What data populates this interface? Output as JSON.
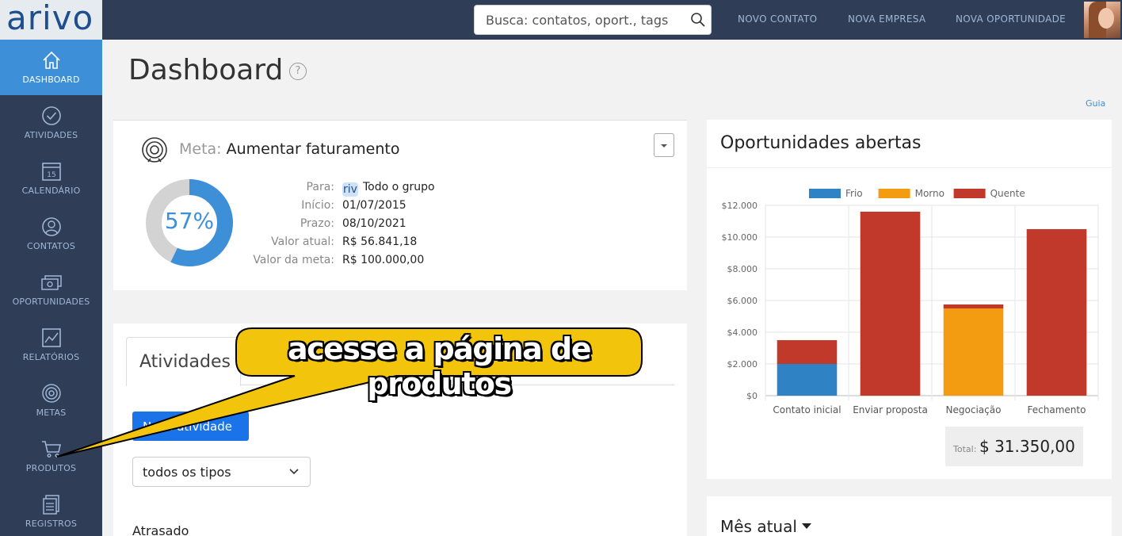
{
  "app": {
    "logo": "arivo"
  },
  "header": {
    "search_placeholder": "Busca: contatos, oport., tags",
    "links": [
      "NOVO CONTATO",
      "NOVA EMPRESA",
      "NOVA OPORTUNIDADE"
    ]
  },
  "sidebar": {
    "items": [
      {
        "label": "DASHBOARD",
        "icon": "home-icon",
        "active": true
      },
      {
        "label": "ATIVIDADES",
        "icon": "check-circle-icon"
      },
      {
        "label": "CALENDÁRIO",
        "icon": "calendar-icon",
        "day": "15"
      },
      {
        "label": "CONTATOS",
        "icon": "contact-icon"
      },
      {
        "label": "OPORTUNIDADES",
        "icon": "money-icon"
      },
      {
        "label": "RELATÓRIOS",
        "icon": "chart-icon"
      },
      {
        "label": "METAS",
        "icon": "target-icon"
      },
      {
        "label": "PRODUTOS",
        "icon": "cart-icon"
      },
      {
        "label": "REGISTROS",
        "icon": "records-icon"
      }
    ]
  },
  "main": {
    "title": "Dashboard",
    "help": "?",
    "guide_link": "Guia"
  },
  "goal": {
    "label": "Meta:",
    "name": "Aumentar faturamento",
    "percent": 57,
    "percent_text": "57%",
    "fields": [
      {
        "key": "Para:",
        "value": "Todo o grupo"
      },
      {
        "key": "Início:",
        "value": "01/07/2015"
      },
      {
        "key": "Prazo:",
        "value": "08/10/2021"
      },
      {
        "key": "Valor atual:",
        "value": "R$ 56.841,18"
      },
      {
        "key": "Valor da meta:",
        "value": "R$ 100.000,00"
      }
    ],
    "team_icon": "riv"
  },
  "activities": {
    "tab": "Atividades",
    "new_button": "Nova atividade",
    "filter_value": "todos os tipos",
    "section": "Atrasado"
  },
  "opportunities": {
    "title": "Oportunidades abertas",
    "total_label": "Total:",
    "total_value": "$ 31.350,00"
  },
  "month": {
    "title": "Mês atual"
  },
  "callout": {
    "text": "acesse a página de produtos",
    "fill": "#f2c40c"
  },
  "colors": {
    "frio": "#2f83c4",
    "morno": "#f39c12",
    "quente": "#c0392b",
    "accent": "#3d8fd8"
  },
  "chart_data": {
    "type": "bar",
    "stacked": true,
    "categories": [
      "Contato inicial",
      "Enviar proposta",
      "Negociação",
      "Fechamento"
    ],
    "series": [
      {
        "name": "Frio",
        "values": [
          2000,
          0,
          0,
          0
        ]
      },
      {
        "name": "Morno",
        "values": [
          0,
          0,
          5500,
          0
        ]
      },
      {
        "name": "Quente",
        "values": [
          1500,
          11600,
          250,
          10500
        ]
      }
    ],
    "ylim": [
      0,
      12000
    ],
    "yticks": [
      "$0",
      "$2.000",
      "$4.000",
      "$6.000",
      "$8.000",
      "$10.000",
      "$12.000"
    ],
    "legend": "top",
    "grid": true
  }
}
